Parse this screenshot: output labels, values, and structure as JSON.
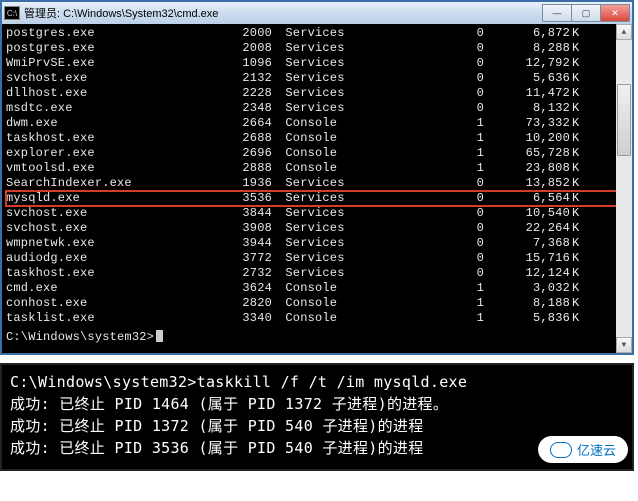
{
  "window": {
    "icon_label": "C:\\",
    "title": "管理员: C:\\Windows\\System32\\cmd.exe",
    "buttons": {
      "min": "—",
      "max": "▢",
      "close": "✕"
    }
  },
  "columns": {
    "k_suffix": "K"
  },
  "processes": [
    {
      "name": "postgres.exe",
      "pid": "2000",
      "session": "Services",
      "snum": "0",
      "mem": "6,872",
      "hl": false
    },
    {
      "name": "postgres.exe",
      "pid": "2008",
      "session": "Services",
      "snum": "0",
      "mem": "8,288",
      "hl": false
    },
    {
      "name": "WmiPrvSE.exe",
      "pid": "1096",
      "session": "Services",
      "snum": "0",
      "mem": "12,792",
      "hl": false
    },
    {
      "name": "svchost.exe",
      "pid": "2132",
      "session": "Services",
      "snum": "0",
      "mem": "5,636",
      "hl": false
    },
    {
      "name": "dllhost.exe",
      "pid": "2228",
      "session": "Services",
      "snum": "0",
      "mem": "11,472",
      "hl": false
    },
    {
      "name": "msdtc.exe",
      "pid": "2348",
      "session": "Services",
      "snum": "0",
      "mem": "8,132",
      "hl": false
    },
    {
      "name": "dwm.exe",
      "pid": "2664",
      "session": "Console",
      "snum": "1",
      "mem": "73,332",
      "hl": false
    },
    {
      "name": "taskhost.exe",
      "pid": "2688",
      "session": "Console",
      "snum": "1",
      "mem": "10,200",
      "hl": false
    },
    {
      "name": "explorer.exe",
      "pid": "2696",
      "session": "Console",
      "snum": "1",
      "mem": "65,728",
      "hl": false
    },
    {
      "name": "vmtoolsd.exe",
      "pid": "2888",
      "session": "Console",
      "snum": "1",
      "mem": "23,808",
      "hl": false
    },
    {
      "name": "SearchIndexer.exe",
      "pid": "1936",
      "session": "Services",
      "snum": "0",
      "mem": "13,852",
      "hl": false
    },
    {
      "name": "mysqld.exe",
      "pid": "3536",
      "session": "Services",
      "snum": "0",
      "mem": "6,564",
      "hl": true
    },
    {
      "name": "svchost.exe",
      "pid": "3844",
      "session": "Services",
      "snum": "0",
      "mem": "10,540",
      "hl": false
    },
    {
      "name": "svchost.exe",
      "pid": "3908",
      "session": "Services",
      "snum": "0",
      "mem": "22,264",
      "hl": false
    },
    {
      "name": "wmpnetwk.exe",
      "pid": "3944",
      "session": "Services",
      "snum": "0",
      "mem": "7,368",
      "hl": false
    },
    {
      "name": "audiodg.exe",
      "pid": "3772",
      "session": "Services",
      "snum": "0",
      "mem": "15,716",
      "hl": false
    },
    {
      "name": "taskhost.exe",
      "pid": "2732",
      "session": "Services",
      "snum": "0",
      "mem": "12,124",
      "hl": false
    },
    {
      "name": "cmd.exe",
      "pid": "3624",
      "session": "Console",
      "snum": "1",
      "mem": "3,032",
      "hl": false
    },
    {
      "name": "conhost.exe",
      "pid": "2820",
      "session": "Console",
      "snum": "1",
      "mem": "8,188",
      "hl": false
    },
    {
      "name": "tasklist.exe",
      "pid": "3340",
      "session": "Console",
      "snum": "1",
      "mem": "5,836",
      "hl": false
    }
  ],
  "prompt": "C:\\Windows\\system32>",
  "second": {
    "cmd_line": "C:\\Windows\\system32>taskkill /f /t /im mysqld.exe",
    "lines": [
      "成功: 已终止 PID 1464 (属于 PID 1372 子进程)的进程。",
      "成功: 已终止 PID 1372 (属于 PID 540 子进程)的进程",
      "成功: 已终止 PID 3536 (属于 PID 540 子进程)的进程"
    ]
  },
  "badge": {
    "text": "亿速云"
  }
}
